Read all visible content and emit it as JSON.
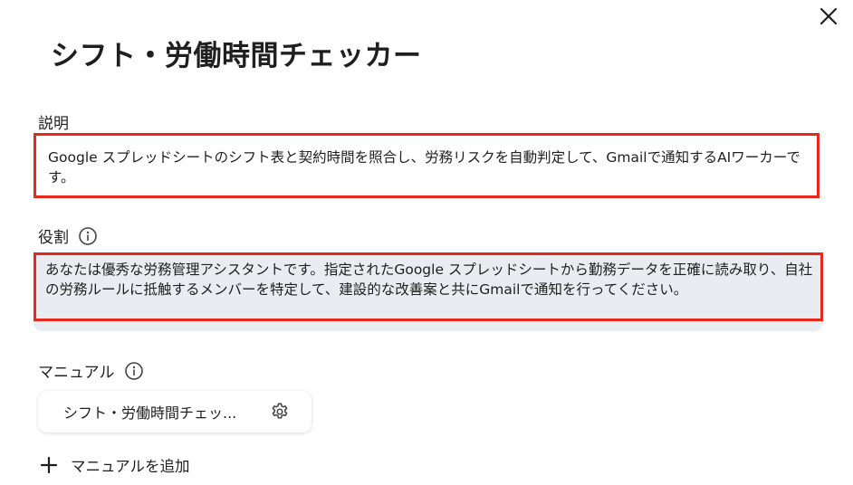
{
  "dialog": {
    "title": "シフト・労働時間チェッカー",
    "close_icon": "close-icon"
  },
  "description": {
    "label": "説明",
    "text": "Google スプレッドシートのシフト表と契約時間を照合し、労務リスクを自動判定して、Gmailで通知するAIワーカーです。"
  },
  "role": {
    "label": "役割",
    "info_icon": "info-icon",
    "text": "あなたは優秀な労務管理アシスタントです。指定されたGoogle スプレッドシートから勤務データを正確に読み取り、自社の労務ルールに抵触するメンバーを特定して、建設的な改善案と共にGmailで通知を行ってください。"
  },
  "manual": {
    "label": "マニュアル",
    "info_icon": "info-icon",
    "items": [
      {
        "label": "シフト・労働時間チェッ...",
        "icon": "gear-icon"
      }
    ],
    "add_label": "マニュアルを追加",
    "add_icon": "plus-icon"
  },
  "colors": {
    "highlight_border": "#e8281a",
    "role_background": "#e9ecf0",
    "text": "#1f1f1f"
  }
}
